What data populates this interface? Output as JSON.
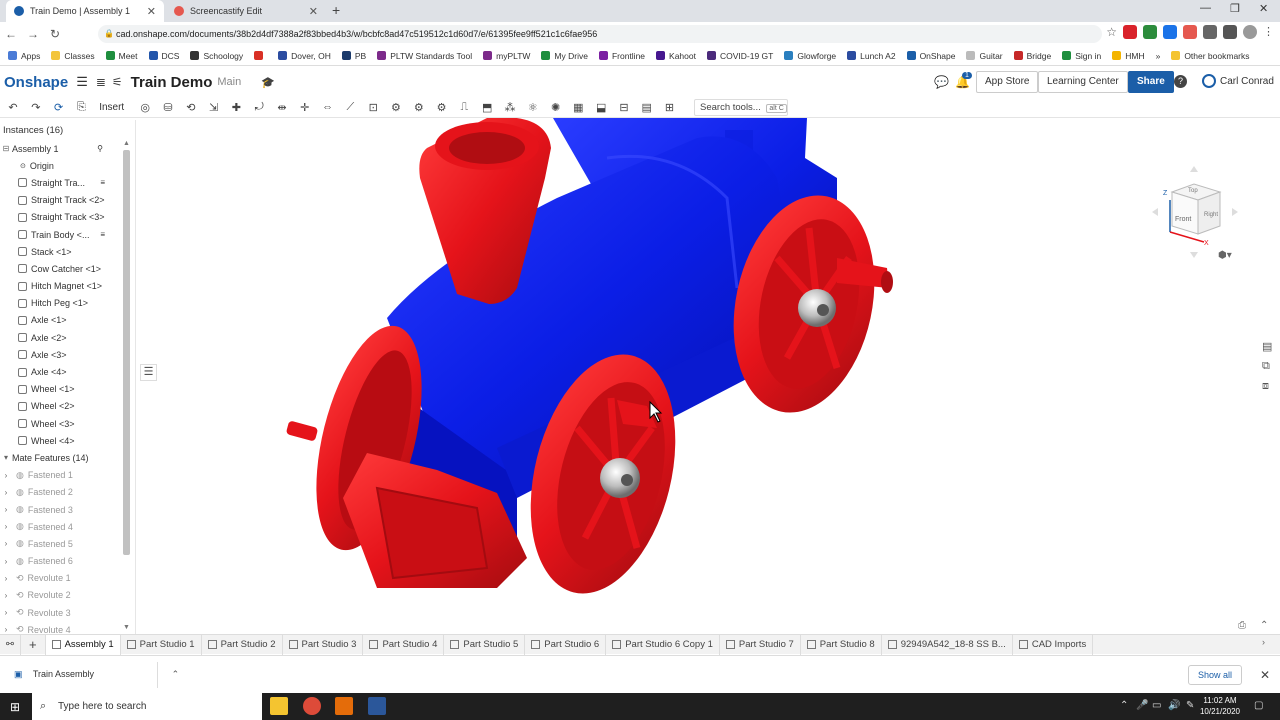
{
  "browser": {
    "tabs": [
      {
        "title": "Train Demo | Assembly 1",
        "active": true
      },
      {
        "title": "Screencastify Edit",
        "active": false
      }
    ],
    "url": "cad.onshape.com/documents/38b2d4df7388a2f83bbed4b3/w/bcbfc8ad47c519512c1d60d7/e/61395fee9ff521c1c6fae956"
  },
  "bookmarks": [
    "Apps",
    "Classes",
    "Meet",
    "DCS",
    "Schoology",
    "",
    "Dover, OH",
    "PB",
    "PLTW Standards Tool",
    "myPLTW",
    "My Drive",
    "Frontline",
    "Kahoot",
    "COVID-19 GT",
    "Glowforge",
    "Lunch A2",
    "OnShape",
    "Guitar",
    "Bridge",
    "Sign in",
    "HMH",
    "Other bookmarks"
  ],
  "bookmark_more": "»",
  "app": {
    "logo": "Onshape",
    "doc_title": "Train Demo",
    "branch": "Main",
    "notification_count": "1",
    "app_store": "App Store",
    "learning_center": "Learning Center",
    "share": "Share",
    "help": "?",
    "user": "Carl Conrad"
  },
  "toolbar": {
    "insert": "Insert",
    "search_tools": "Search tools...",
    "search_shortcut": "alt C"
  },
  "instances": {
    "header": "Instances (16)",
    "items": [
      {
        "label": "Assembly 1",
        "kind": "root"
      },
      {
        "label": "Origin",
        "kind": "origin"
      },
      {
        "label": "Straight Tra...",
        "kind": "part"
      },
      {
        "label": "Straight Track <2>",
        "kind": "part"
      },
      {
        "label": "Straight Track <3>",
        "kind": "part"
      },
      {
        "label": "Train Body <...",
        "kind": "part"
      },
      {
        "label": "Stack <1>",
        "kind": "part"
      },
      {
        "label": "Cow Catcher <1>",
        "kind": "part"
      },
      {
        "label": "Hitch Magnet <1>",
        "kind": "part"
      },
      {
        "label": "Hitch Peg <1>",
        "kind": "part"
      },
      {
        "label": "Axle <1>",
        "kind": "part"
      },
      {
        "label": "Axle <2>",
        "kind": "part"
      },
      {
        "label": "Axle <3>",
        "kind": "part"
      },
      {
        "label": "Axle <4>",
        "kind": "part"
      },
      {
        "label": "Wheel <1>",
        "kind": "part"
      },
      {
        "label": "Wheel <2>",
        "kind": "part"
      },
      {
        "label": "Wheel <3>",
        "kind": "part"
      },
      {
        "label": "Wheel <4>",
        "kind": "part"
      }
    ],
    "mate_header": "Mate Features (14)",
    "mates": [
      "Fastened 1",
      "Fastened 2",
      "Fastened 3",
      "Fastened 4",
      "Fastened 5",
      "Fastened 6",
      "Revolute 1",
      "Revolute 2",
      "Revolute 3",
      "Revolute 4"
    ]
  },
  "viewcube": {
    "top": "Top",
    "front": "Front",
    "right": "Right",
    "z": "Z",
    "x": "X"
  },
  "bottom_tabs": [
    "Assembly 1",
    "Part Studio 1",
    "Part Studio 2",
    "Part Studio 3",
    "Part Studio 4",
    "Part Studio 5",
    "Part Studio 6",
    "Part Studio 6 Copy 1",
    "Part Studio 7",
    "Part Studio 8",
    "92949A542_18-8 SS B...",
    "CAD Imports"
  ],
  "downloads": {
    "item": "Train Assembly",
    "show_all": "Show all"
  },
  "taskbar": {
    "search": "Type here to search",
    "time": "11:02 AM",
    "date": "10/21/2020"
  },
  "colors": {
    "accent": "#1b5ea8",
    "body_blue": "#0a1ee0",
    "wheel_red": "#e5131a"
  }
}
